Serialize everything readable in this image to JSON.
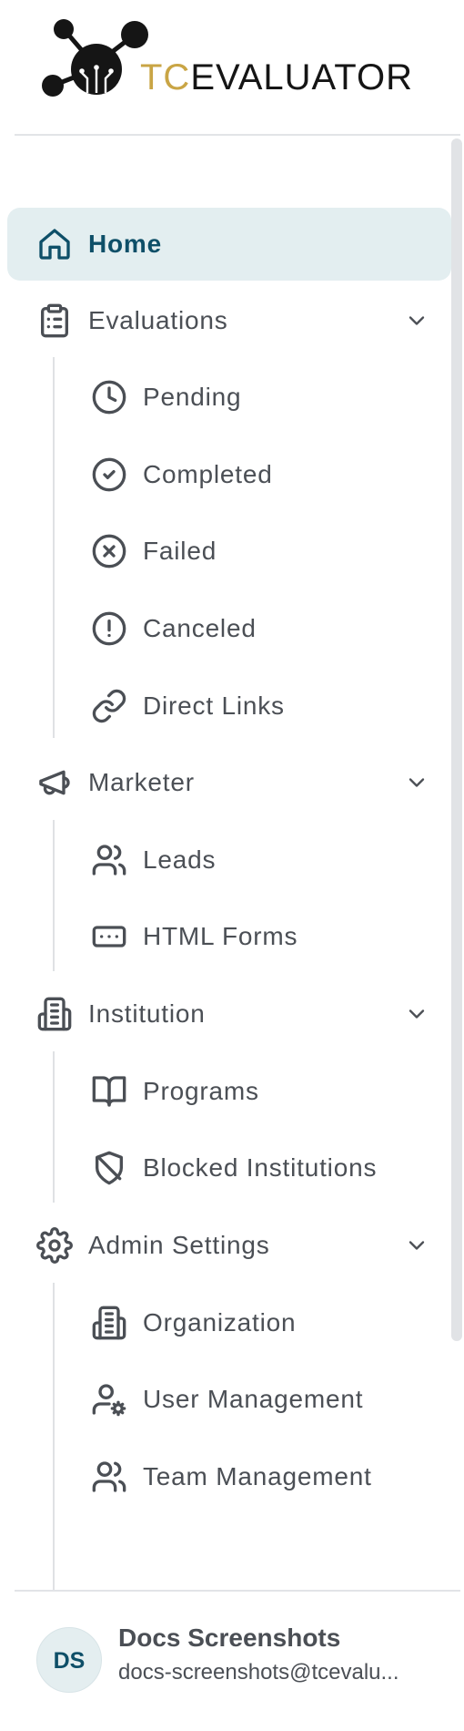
{
  "brand": {
    "logo_prefix": "TC",
    "logo_suffix": "EVALUATOR",
    "accent_color": "#c9a545",
    "dark_color": "#151515",
    "primary_color": "#0e4f68"
  },
  "nav": {
    "home": {
      "label": "Home",
      "icon": "home-icon"
    },
    "evaluations": {
      "label": "Evaluations",
      "icon": "clipboard-list-icon",
      "items": [
        {
          "label": "Pending",
          "icon": "clock-icon"
        },
        {
          "label": "Completed",
          "icon": "check-circle-icon"
        },
        {
          "label": "Failed",
          "icon": "x-circle-icon"
        },
        {
          "label": "Canceled",
          "icon": "alert-circle-icon"
        },
        {
          "label": "Direct Links",
          "icon": "link-icon"
        }
      ]
    },
    "marketer": {
      "label": "Marketer",
      "icon": "megaphone-icon",
      "items": [
        {
          "label": "Leads",
          "icon": "users-icon"
        },
        {
          "label": "HTML Forms",
          "icon": "form-input-icon"
        }
      ]
    },
    "institution": {
      "label": "Institution",
      "icon": "building-icon",
      "items": [
        {
          "label": "Programs",
          "icon": "book-open-icon"
        },
        {
          "label": "Blocked Institutions",
          "icon": "shield-off-icon"
        }
      ]
    },
    "admin_settings": {
      "label": "Admin Settings",
      "icon": "gear-icon",
      "items": [
        {
          "label": "Organization",
          "icon": "building-icon"
        },
        {
          "label": "User Management",
          "icon": "user-cog-icon"
        },
        {
          "label": "Team Management",
          "icon": "users-icon"
        }
      ]
    }
  },
  "user": {
    "initials": "DS",
    "name": "Docs Screenshots",
    "email": "docs-screenshots@tcevalu..."
  }
}
